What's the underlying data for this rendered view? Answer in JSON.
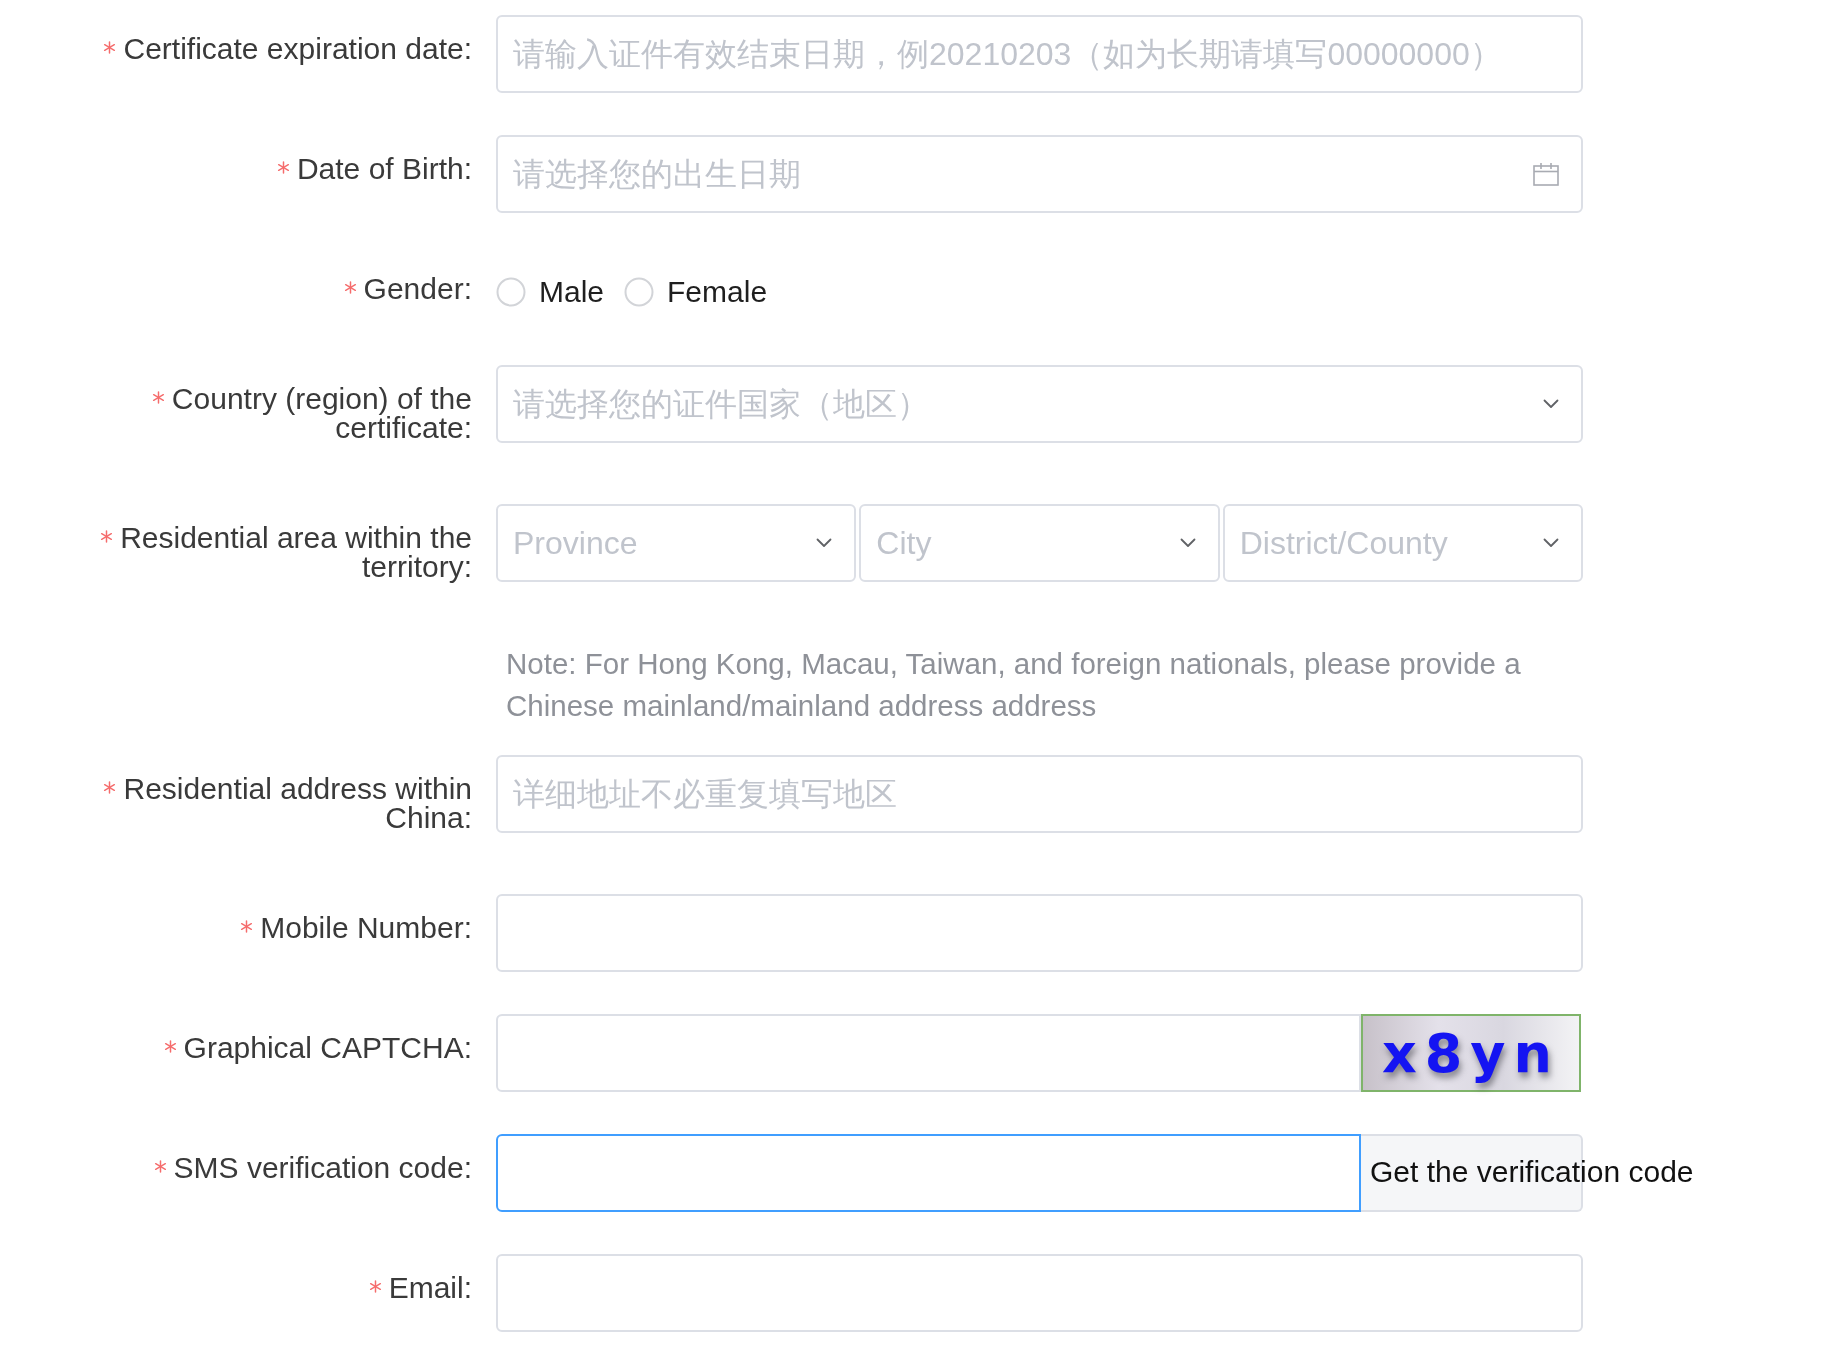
{
  "form": {
    "fields": [
      {
        "kind": "text",
        "label": "Certificate expiration date:",
        "required": true,
        "focused": false,
        "placeholder": "请输入证件有效结束日期，例20210203（如为长期请填写00000000）"
      },
      {
        "kind": "date",
        "label": "Date of Birth:",
        "required": true,
        "focused": false,
        "placeholder": "请选择您的出生日期"
      },
      {
        "kind": "radio",
        "label": "Gender:",
        "required": true,
        "options": [
          {
            "label": "Male",
            "selected": false
          },
          {
            "label": "Female",
            "selected": false
          }
        ]
      },
      {
        "kind": "select",
        "label": "Country (region) of the certificate:",
        "required": true,
        "focused": false,
        "placeholder": "请选择您的证件国家（地区）"
      },
      {
        "kind": "cascade",
        "label": "Residential area within the territory:",
        "required": true,
        "selects": [
          {
            "placeholder": "Province",
            "focused": false
          },
          {
            "placeholder": "City",
            "focused": false
          },
          {
            "placeholder": "District/County",
            "focused": false
          }
        ]
      },
      {
        "kind": "note",
        "text": "Note: For Hong Kong, Macau, Taiwan, and foreign nationals, please provide a Chinese mainland/mainland address address"
      },
      {
        "kind": "text",
        "label": "Residential address within China:",
        "required": true,
        "focused": false,
        "placeholder": "详细地址不必重复填写地区"
      },
      {
        "kind": "text",
        "label": "Mobile Number:",
        "required": true,
        "focused": false
      },
      {
        "kind": "captcha",
        "label": "Graphical CAPTCHA:",
        "required": true,
        "focused": false,
        "captcha": "x8yn"
      },
      {
        "kind": "sms",
        "label": "SMS verification code:",
        "required": true,
        "focused": true,
        "button": "Get the verification code"
      },
      {
        "kind": "text",
        "label": "Email:",
        "required": true,
        "focused": false
      }
    ]
  }
}
